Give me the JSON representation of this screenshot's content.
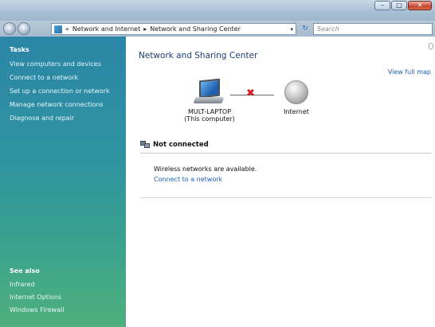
{
  "window": {
    "buttons": {
      "minimize": "–",
      "maximize": "□",
      "close": "✕"
    }
  },
  "address_bar": {
    "chevron": "«",
    "crumbs": [
      "Network and Internet",
      "Network and Sharing Center"
    ],
    "separator": "▸",
    "dropdown": "▾",
    "refresh": "↻",
    "search_placeholder": "Search"
  },
  "nav": {
    "back": "‹",
    "forward": "›"
  },
  "left_pane": {
    "tasks_heading": "Tasks",
    "tasks": [
      "View computers and devices",
      "Connect to a network",
      "Set up a connection or network",
      "Manage network connections",
      "Diagnose and repair"
    ],
    "see_also_heading": "See also",
    "see_also": [
      "Infrared",
      "Internet Options",
      "Windows Firewall"
    ]
  },
  "main": {
    "title": "Network and Sharing Center",
    "view_full_map": "View full map",
    "computer_name": "MULT-LAPTOP",
    "computer_sub": "(This computer)",
    "internet_label": "Internet",
    "status": "Not connected",
    "info": "Wireless networks are available.",
    "connect_link": "Connect to a network"
  },
  "colors": {
    "link": "#1c5db8",
    "title": "#1e3e73",
    "pane_top": "#2b86a6",
    "pane_bottom": "#4fb07b",
    "error_x": "#d11a1a"
  }
}
